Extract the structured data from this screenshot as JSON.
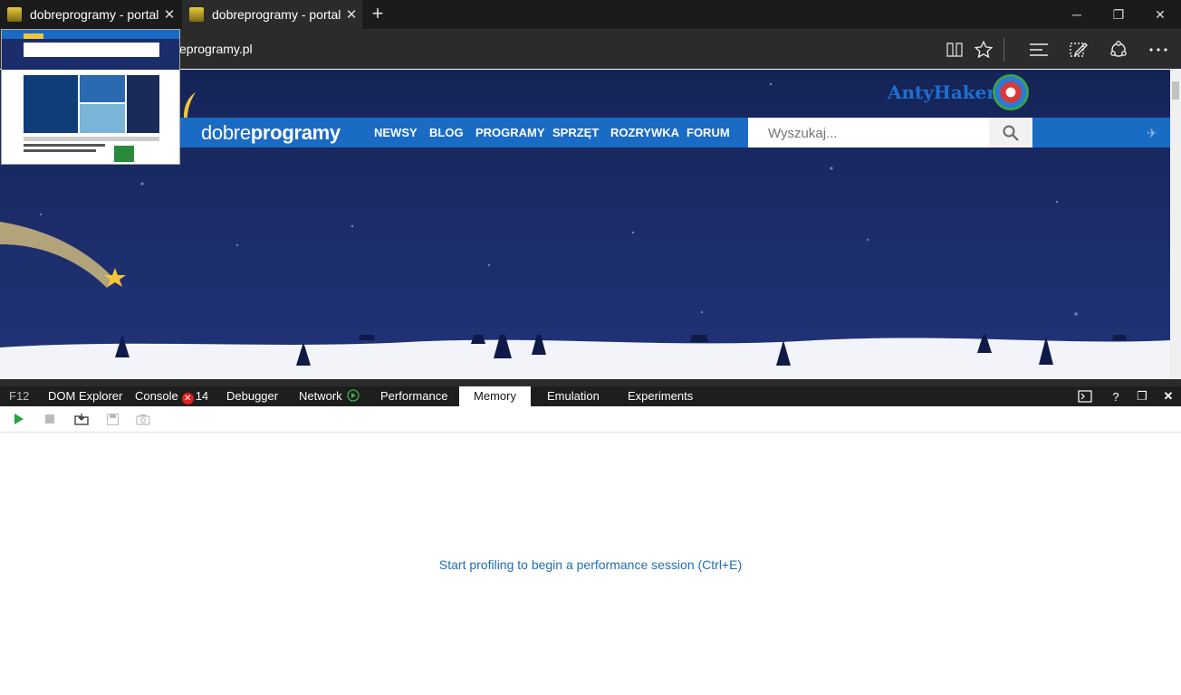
{
  "browser": {
    "tabs": [
      {
        "title": "dobreprogramy - portal",
        "active": false
      },
      {
        "title": "dobreprogramy - portal",
        "active": true
      }
    ],
    "new_tab_icon": "+",
    "window_controls": {
      "minimize": "─",
      "restore": "❐",
      "close": "✕"
    },
    "url": "eprogramy.pl",
    "toolbar_icons": [
      "reading-view-icon",
      "favorite-star-icon",
      "hub-icon",
      "web-note-icon",
      "share-icon",
      "more-icon"
    ]
  },
  "site": {
    "logo_regular": "dobre",
    "logo_bold": "programy",
    "nav": [
      "NEWSY",
      "BLOG",
      "PROGRAMY",
      "SPRZĘT",
      "ROZRYWKA",
      "FORUM"
    ],
    "search_placeholder": "Wyszukaj...",
    "user_name": "AntyHaker",
    "colors": {
      "nav": "#1a6bc3",
      "sky": "#1c2d6b",
      "user": "#1e6fd0"
    }
  },
  "devtools": {
    "tabs": [
      "F12",
      "DOM Explorer",
      "Console",
      "Debugger",
      "Network",
      "Performance",
      "Memory",
      "Emulation",
      "Experiments"
    ],
    "active_tab": "Memory",
    "console_error_count": "14",
    "message": "Start profiling to begin a performance session (Ctrl+E)",
    "colors": {
      "message": "#1f6fb0",
      "error": "#e01f1f"
    }
  }
}
